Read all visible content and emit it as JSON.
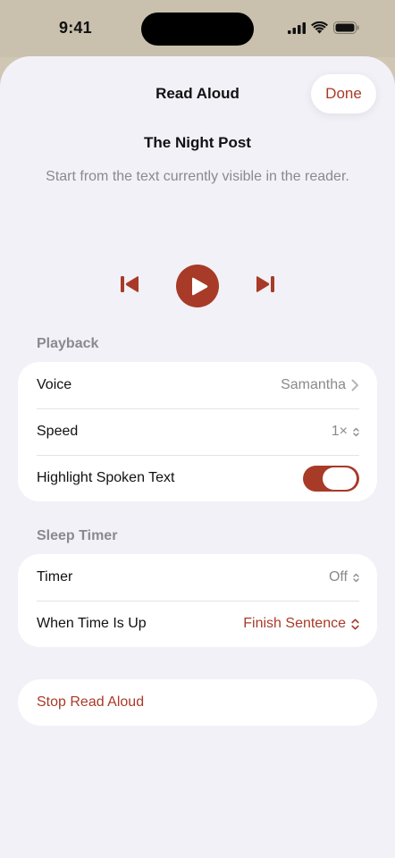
{
  "status": {
    "time": "9:41"
  },
  "sheet": {
    "title": "Read Aloud",
    "done_label": "Done"
  },
  "document": {
    "title": "The Night Post",
    "subtitle": "Start from the text currently visible in the reader."
  },
  "playback": {
    "label": "Playback",
    "voice_label": "Voice",
    "voice_value": "Samantha",
    "speed_label": "Speed",
    "speed_value": "1×",
    "highlight_label": "Highlight Spoken Text",
    "highlight_on": true
  },
  "sleep_timer": {
    "label": "Sleep Timer",
    "timer_label": "Timer",
    "timer_value": "Off",
    "when_label": "When Time Is Up",
    "when_value": "Finish Sentence"
  },
  "stop_label": "Stop Read Aloud",
  "colors": {
    "accent": "#a83a28",
    "sheet_bg": "#f2f1f7",
    "secondary_text": "#8a8a8e"
  }
}
